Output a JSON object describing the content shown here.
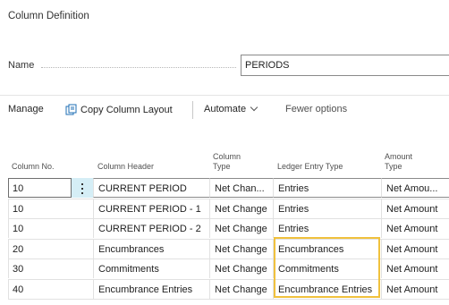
{
  "page": {
    "title": "Column Definition"
  },
  "name_field": {
    "label": "Name",
    "value": "PERIODS"
  },
  "actions": {
    "manage": "Manage",
    "copy_layout": "Copy Column Layout",
    "automate": "Automate",
    "fewer_options": "Fewer options"
  },
  "grid": {
    "headers": {
      "column_no": "Column No.",
      "column_header": "Column Header",
      "column_type_1": "Column",
      "column_type_2": "Type",
      "ledger_entry_type": "Ledger Entry Type",
      "amount_type_1": "Amount",
      "amount_type_2": "Type"
    },
    "rows": [
      {
        "no": "10",
        "header": "CURRENT PERIOD",
        "type": "Net Chan...",
        "ledger": "Entries",
        "amount": "Net Amou..."
      },
      {
        "no": "10",
        "header": "CURRENT PERIOD - 1",
        "type": "Net Change",
        "ledger": "Entries",
        "amount": "Net Amount"
      },
      {
        "no": "10",
        "header": "CURRENT PERIOD - 2",
        "type": "Net Change",
        "ledger": "Entries",
        "amount": "Net Amount"
      },
      {
        "no": "20",
        "header": "Encumbrances",
        "type": "Net Change",
        "ledger": "Encumbrances",
        "amount": "Net Amount"
      },
      {
        "no": "30",
        "header": "Commitments",
        "type": "Net Change",
        "ledger": "Commitments",
        "amount": "Net Amount"
      },
      {
        "no": "40",
        "header": "Encumbrance Entries",
        "type": "Net Change",
        "ledger": "Encumbrance Entries",
        "amount": "Net Amount"
      }
    ]
  },
  "colors": {
    "highlight": "#f0c13d",
    "selected_menu": "#d5eef6",
    "link_icon": "#1f6fb5"
  }
}
